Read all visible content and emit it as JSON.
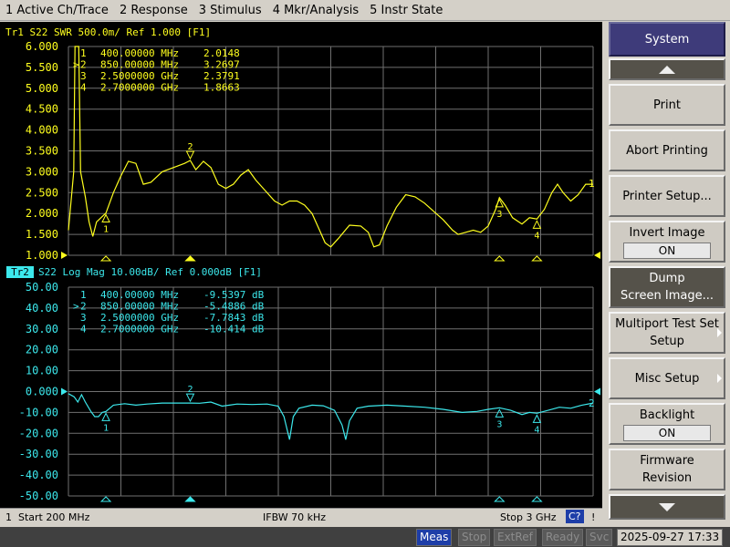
{
  "menu": [
    "1 Active Ch/Trace",
    "2 Response",
    "3 Stimulus",
    "4 Mkr/Analysis",
    "5 Instr State"
  ],
  "colors": {
    "trace1": "#ffff1e",
    "trace2": "#3ce8ec",
    "grid": "#707070",
    "background": "#000000"
  },
  "trace1": {
    "header": "Tr1  S22  SWR 500.0m/ Ref 1.000 [F1]",
    "y_ticks": [
      "6.000",
      "5.500",
      "5.000",
      "4.500",
      "4.000",
      "3.500",
      "3.000",
      "2.500",
      "2.000",
      "1.500",
      "1.000"
    ],
    "markers": [
      {
        "sel": "",
        "num": "1",
        "freq": "400.00000 MHz",
        "val": "2.0148"
      },
      {
        "sel": ">",
        "num": "2",
        "freq": "850.00000 MHz",
        "val": "3.2697"
      },
      {
        "sel": "",
        "num": "3",
        "freq": "2.5000000 GHz",
        "val": "2.3791"
      },
      {
        "sel": "",
        "num": "4",
        "freq": "2.7000000 GHz",
        "val": "1.8663"
      }
    ],
    "end_label": "1"
  },
  "trace2": {
    "label": "Tr2",
    "header": "S22  Log Mag 10.00dB/ Ref 0.000dB [F1]",
    "y_ticks": [
      "50.00",
      "40.00",
      "30.00",
      "20.00",
      "10.00",
      "0.000",
      "-10.00",
      "-20.00",
      "-30.00",
      "-40.00",
      "-50.00"
    ],
    "markers": [
      {
        "sel": "",
        "num": "1",
        "freq": "400.00000 MHz",
        "val": "-9.5397 dB"
      },
      {
        "sel": ">",
        "num": "2",
        "freq": "850.00000 MHz",
        "val": "-5.4886 dB"
      },
      {
        "sel": "",
        "num": "3",
        "freq": "2.5000000 GHz",
        "val": "-7.7843 dB"
      },
      {
        "sel": "",
        "num": "4",
        "freq": "2.7000000 GHz",
        "val": "-10.414 dB"
      }
    ],
    "end_label": "2"
  },
  "status": {
    "channel": "1",
    "start": "Start 200 MHz",
    "ifbw": "IFBW 70 kHz",
    "stop": "Stop 3 GHz",
    "cal": "C?",
    "flag": "!"
  },
  "softkeys": {
    "title": "System",
    "print": "Print",
    "abort": "Abort Printing",
    "printer_setup": "Printer Setup...",
    "invert_image": "Invert Image",
    "invert_value": "ON",
    "dump_1": "Dump",
    "dump_2": "Screen Image...",
    "multiport_1": "Multiport Test Set",
    "multiport_2": "Setup",
    "misc": "Misc Setup",
    "backlight": "Backlight",
    "backlight_value": "ON",
    "firmware_1": "Firmware",
    "firmware_2": "Revision"
  },
  "bottom": {
    "meas": "Meas",
    "stop": "Stop",
    "extref": "ExtRef",
    "ready": "Ready",
    "svc": "Svc",
    "datetime": "2025-09-27 17:33"
  }
}
